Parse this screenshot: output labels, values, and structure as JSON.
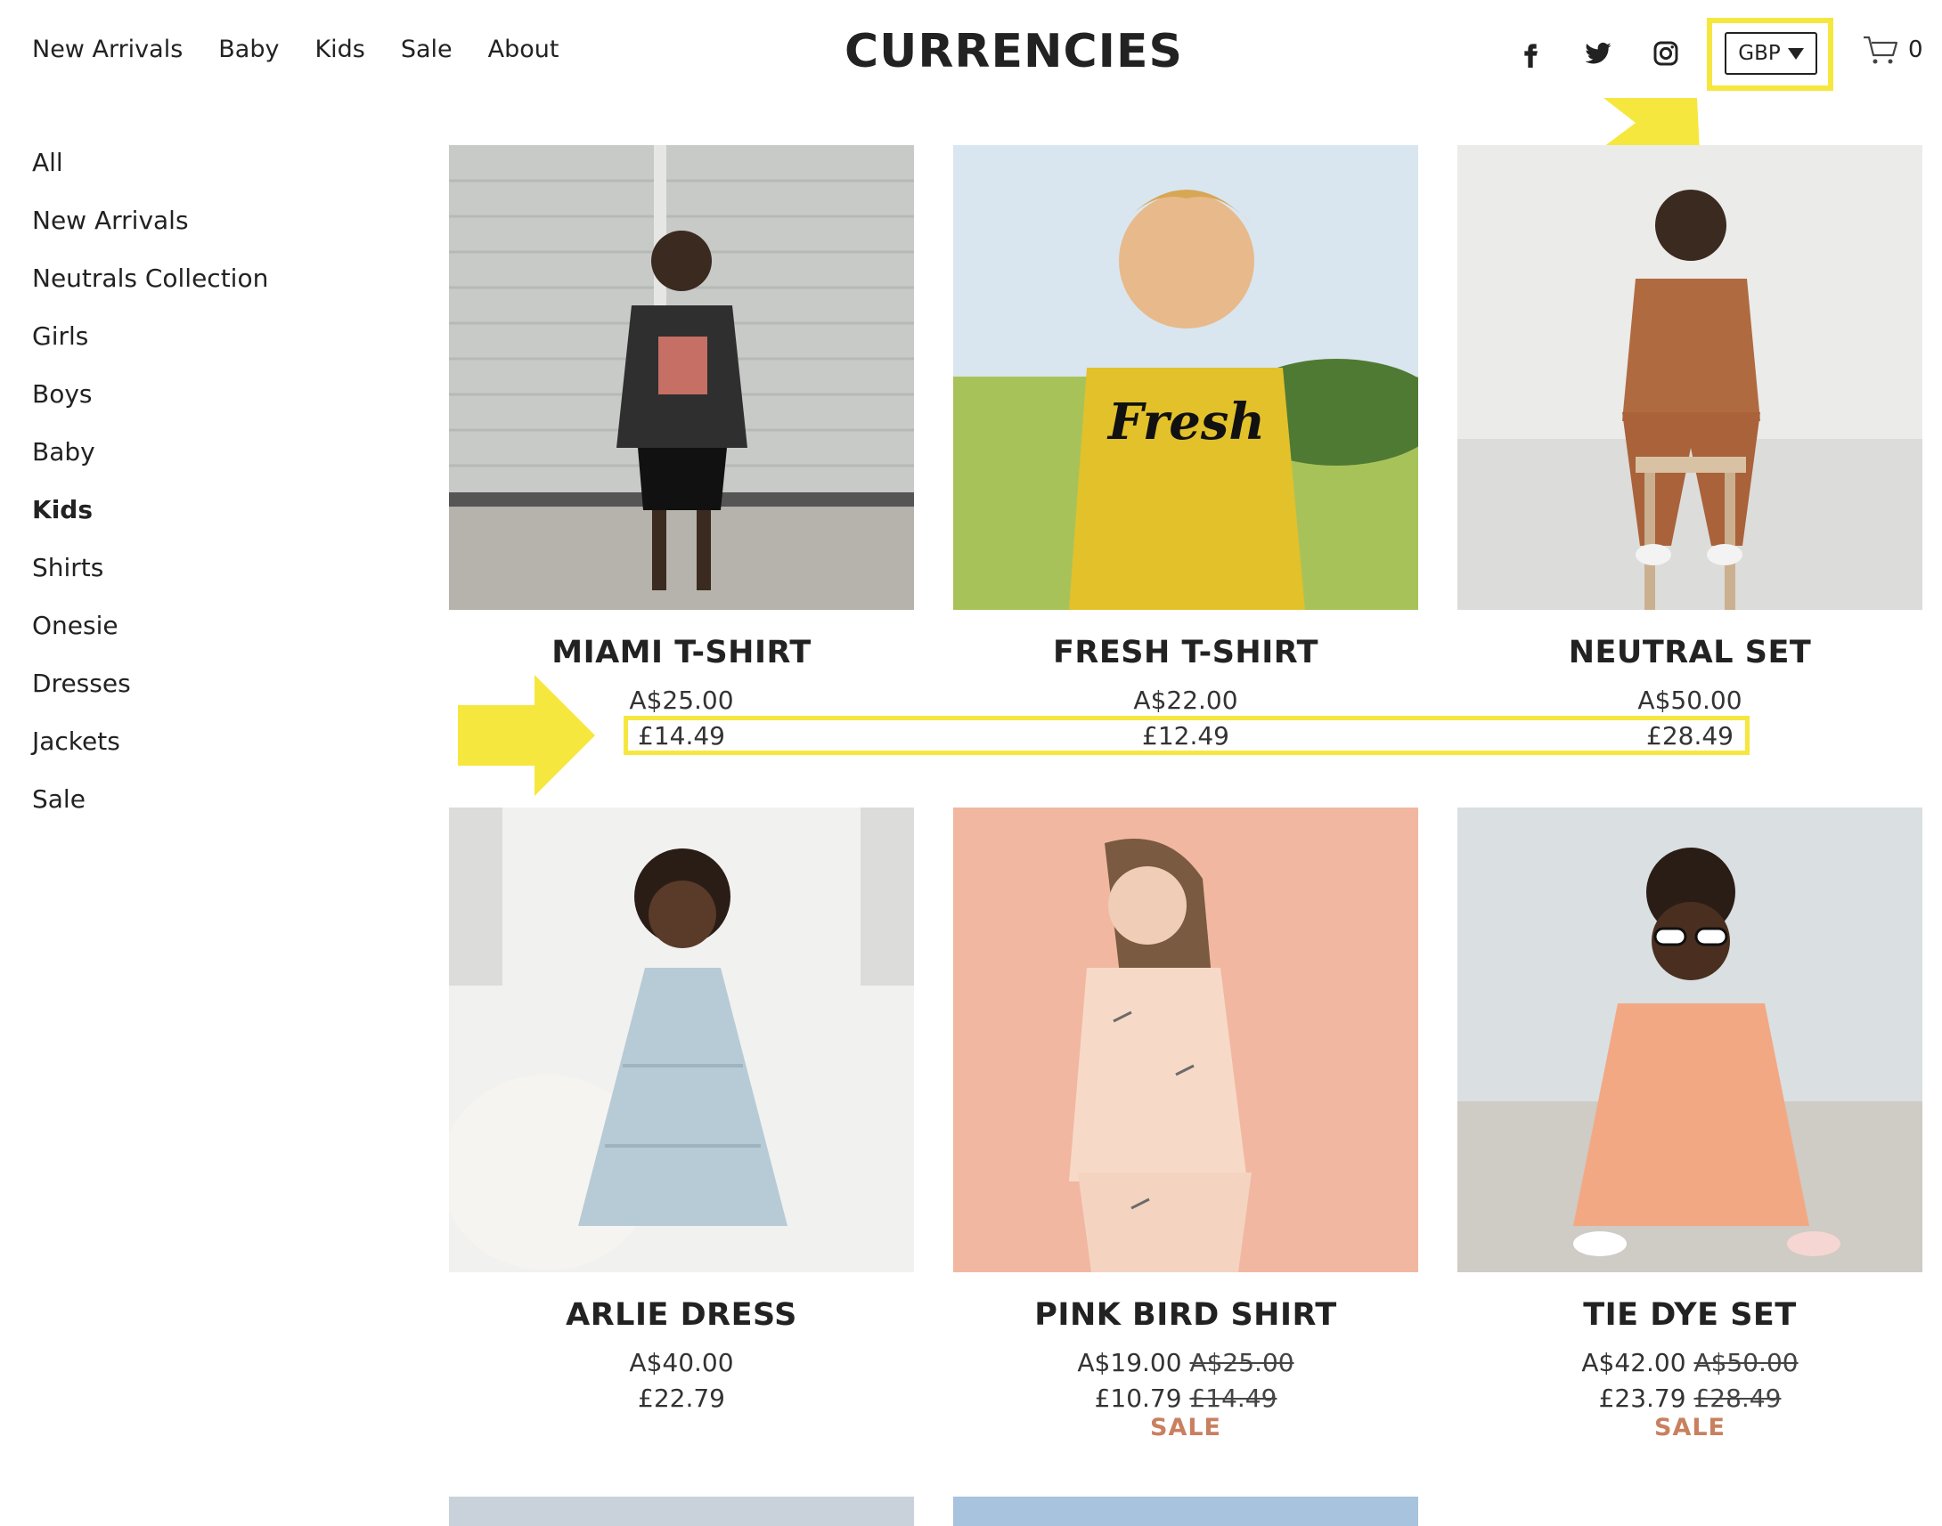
{
  "header": {
    "nav": [
      "New Arrivals",
      "Baby",
      "Kids",
      "Sale",
      "About"
    ],
    "logo": "CURRENCIES",
    "social_icons": [
      "facebook-icon",
      "twitter-icon",
      "instagram-icon"
    ],
    "currency": "GBP",
    "cart_count": "0"
  },
  "sidebar": {
    "items": [
      "All",
      "New Arrivals",
      "Neutrals Collection",
      "Girls",
      "Boys",
      "Baby",
      "Kids",
      "Shirts",
      "Onesie",
      "Dresses",
      "Jackets",
      "Sale"
    ],
    "active": "Kids"
  },
  "products": [
    {
      "name": "MIAMI T-SHIRT",
      "price_aud": "A$25.00",
      "price_gbp": "£14.49"
    },
    {
      "name": "FRESH T-SHIRT",
      "price_aud": "A$22.00",
      "price_gbp": "£12.49"
    },
    {
      "name": "NEUTRAL SET",
      "price_aud": "A$50.00",
      "price_gbp": "£28.49"
    },
    {
      "name": "ARLIE DRESS",
      "price_aud": "A$40.00",
      "price_gbp": "£22.79"
    },
    {
      "name": "PINK BIRD SHIRT",
      "price_aud": "A$19.00",
      "price_aud_was": "A$25.00",
      "price_gbp": "£10.79",
      "price_gbp_was": "£14.49",
      "badge": "SALE"
    },
    {
      "name": "TIE DYE SET",
      "price_aud": "A$42.00",
      "price_aud_was": "A$50.00",
      "price_gbp": "£23.79",
      "price_gbp_was": "£28.49",
      "badge": "SALE"
    }
  ],
  "colors": {
    "highlight": "#f6e73f",
    "sale": "#c9805f",
    "text": "#222222"
  }
}
